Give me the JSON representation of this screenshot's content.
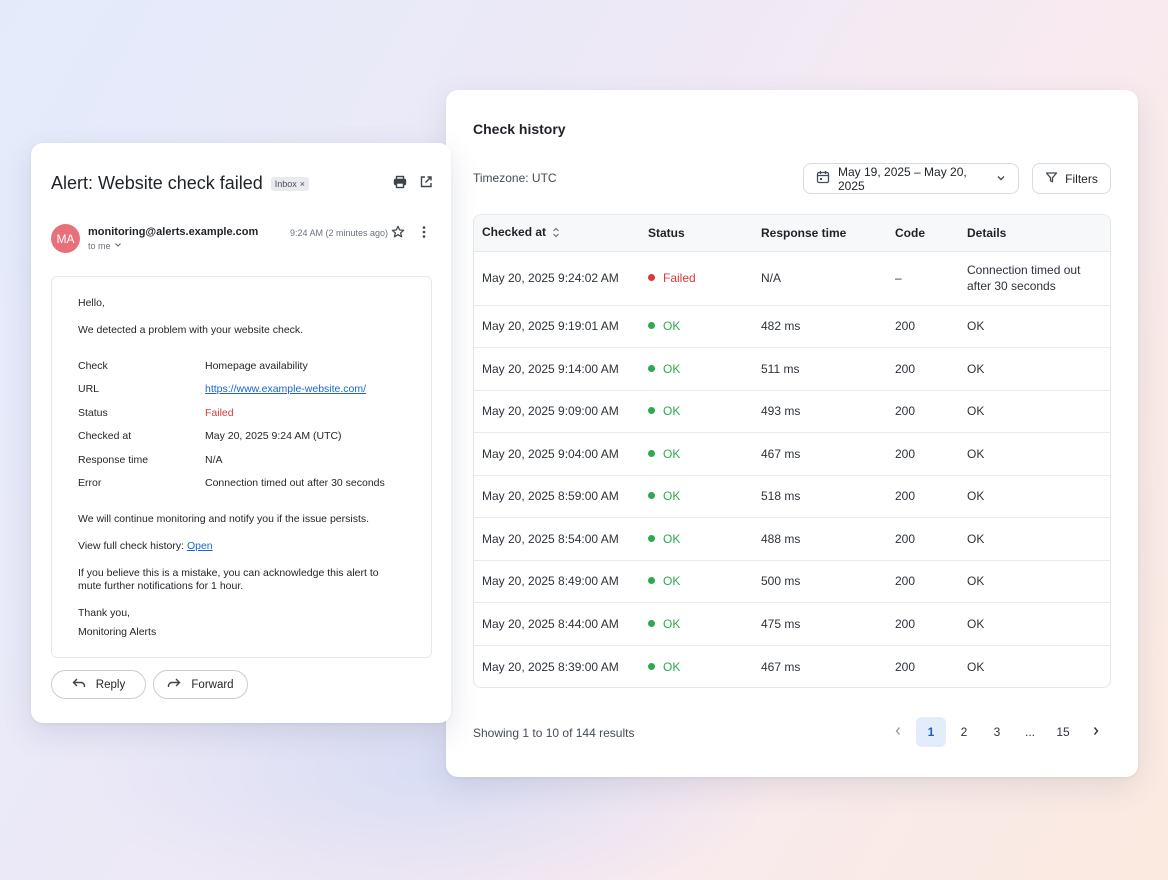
{
  "check_history": {
    "title": "Check history",
    "timezone": "Timezone: UTC",
    "date_range": "May 19, 2025 – May 20, 2025",
    "filters_label": "Filters",
    "columns": [
      "Checked at",
      "Status",
      "Response time",
      "Code",
      "Details"
    ],
    "rows": [
      {
        "checked_at": "May 20, 2025 9:24:02 AM",
        "status": "Failed",
        "response_time": "N/A",
        "code": "–",
        "details": "Connection timed out after 30 seconds"
      },
      {
        "checked_at": "May 20, 2025 9:19:01 AM",
        "status": "OK",
        "response_time": "482 ms",
        "code": "200",
        "details": "OK"
      },
      {
        "checked_at": "May 20, 2025 9:14:00 AM",
        "status": "OK",
        "response_time": "511 ms",
        "code": "200",
        "details": "OK"
      },
      {
        "checked_at": "May 20, 2025 9:09:00 AM",
        "status": "OK",
        "response_time": "493 ms",
        "code": "200",
        "details": "OK"
      },
      {
        "checked_at": "May 20, 2025 9:04:00 AM",
        "status": "OK",
        "response_time": "467 ms",
        "code": "200",
        "details": "OK"
      },
      {
        "checked_at": "May 20, 2025 8:59:00 AM",
        "status": "OK",
        "response_time": "518 ms",
        "code": "200",
        "details": "OK"
      },
      {
        "checked_at": "May 20, 2025 8:54:00 AM",
        "status": "OK",
        "response_time": "488 ms",
        "code": "200",
        "details": "OK"
      },
      {
        "checked_at": "May 20, 2025 8:49:00 AM",
        "status": "OK",
        "response_time": "500 ms",
        "code": "200",
        "details": "OK"
      },
      {
        "checked_at": "May 20, 2025 8:44:00 AM",
        "status": "OK",
        "response_time": "475 ms",
        "code": "200",
        "details": "OK"
      },
      {
        "checked_at": "May 20, 2025 8:39:00 AM",
        "status": "OK",
        "response_time": "467 ms",
        "code": "200",
        "details": "OK"
      }
    ],
    "footer": "Showing 1 to 10 of 144 results",
    "pagination": {
      "pages": [
        "1",
        "2",
        "3",
        "...",
        "15"
      ],
      "active": "1"
    },
    "colors": {
      "ok": "#2fa84f",
      "failed": "#d93a3a",
      "accent": "#1f5fc4"
    }
  },
  "email": {
    "subject": "Alert: Website check failed",
    "badge": "Inbox",
    "avatar_initials": "MA",
    "sender": "monitoring@alerts.example.com",
    "to": "to me",
    "time": "9:24 AM (2 minutes ago)",
    "greeting": "Hello,",
    "intro": "We detected a problem with your website check.",
    "fields": [
      {
        "key": "Check",
        "value": "Homepage availability"
      },
      {
        "key": "URL",
        "value": "https://www.example-website.com/"
      },
      {
        "key": "Status",
        "value": "Failed"
      },
      {
        "key": "Checked at",
        "value": "May 20, 2025 9:24 AM (UTC)"
      },
      {
        "key": "Response time",
        "value": "N/A"
      },
      {
        "key": "Error",
        "value": "Connection timed out after 30 seconds"
      }
    ],
    "continue_text": "We will continue monitoring and notify you if the issue persists.",
    "history_text": "View full check history:",
    "history_link": "Open",
    "mistake_line1": "If you believe this is a mistake, you can acknowledge this alert to",
    "mistake_line2": "mute further notifications for 1 hour.",
    "thanks": "Thank you,",
    "signature": "Monitoring Alerts",
    "reply_label": "Reply",
    "forward_label": "Forward"
  }
}
